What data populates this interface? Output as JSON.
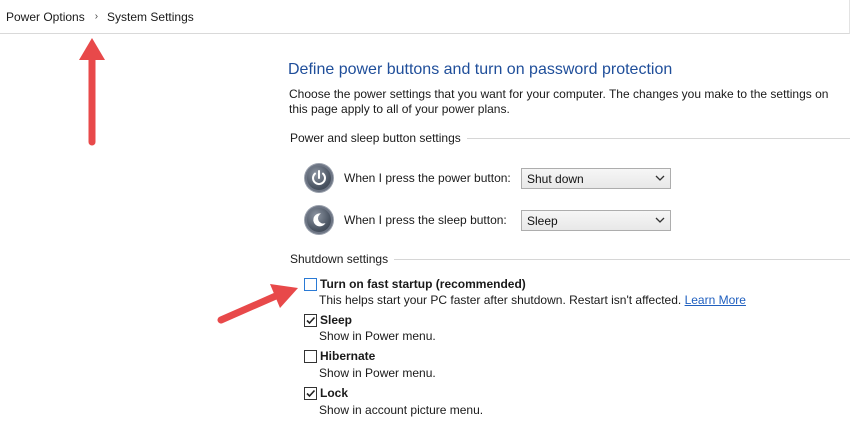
{
  "breadcrumb": {
    "items": [
      "Power Options",
      "System Settings"
    ],
    "separator": "›"
  },
  "page": {
    "title": "Define power buttons and turn on password protection",
    "intro": "Choose the power settings that you want for your computer. The changes you make to the settings on this page apply to all of your power plans."
  },
  "power_sleep": {
    "heading": "Power and sleep button settings",
    "power_button": {
      "label": "When I press the power button:",
      "value": "Shut down",
      "icon": "power-icon"
    },
    "sleep_button": {
      "label": "When I press the sleep button:",
      "value": "Sleep",
      "icon": "sleep-icon"
    }
  },
  "shutdown": {
    "heading": "Shutdown settings",
    "fast_startup": {
      "title": "Turn on fast startup (recommended)",
      "desc": "This helps start your PC faster after shutdown. Restart isn't affected.",
      "link": "Learn More",
      "checked": false
    },
    "sleep": {
      "title": "Sleep",
      "desc": "Show in Power menu.",
      "checked": true
    },
    "hibernate": {
      "title": "Hibernate",
      "desc": "Show in Power menu.",
      "checked": false
    },
    "lock": {
      "title": "Lock",
      "desc": "Show in account picture menu.",
      "checked": true
    }
  },
  "annotation": {
    "arrow_color": "#e8494a",
    "arrows": [
      "up-arrow",
      "right-arrow"
    ]
  }
}
